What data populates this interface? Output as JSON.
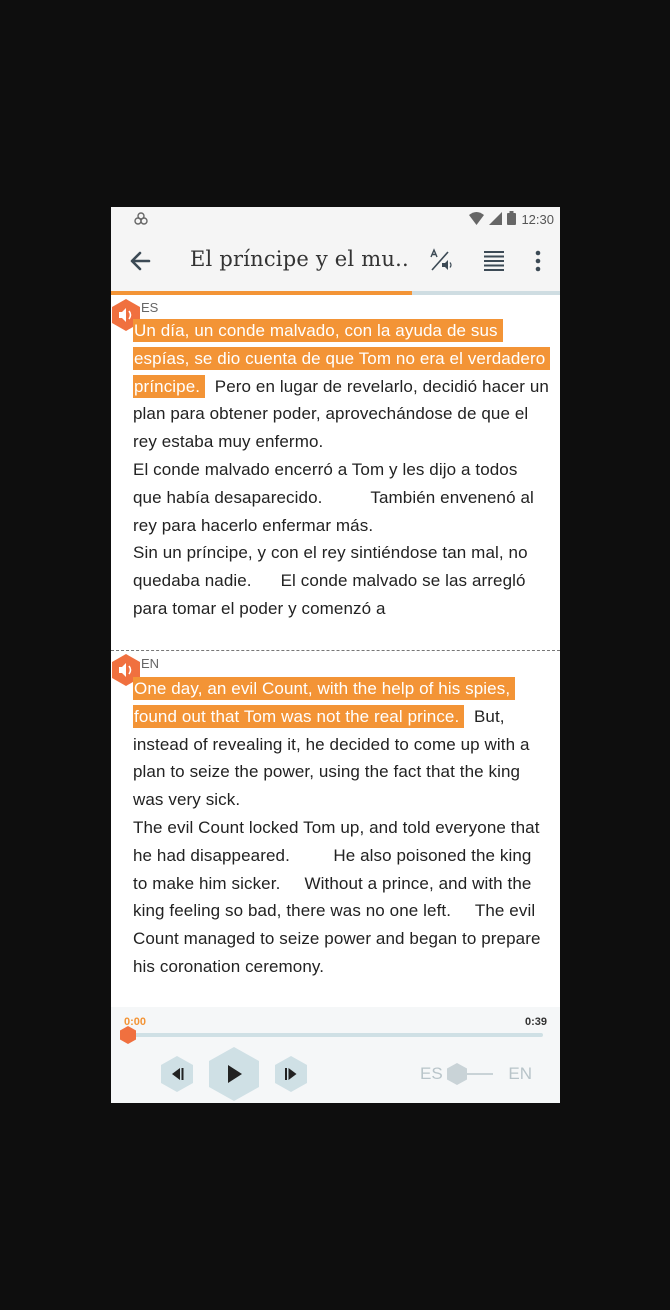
{
  "status_bar": {
    "time": "12:30"
  },
  "toolbar": {
    "title": "El príncipe y el mu..."
  },
  "reading_progress": 0.67,
  "spanish": {
    "lang_code": "ES",
    "highlighted": "Un día, un conde malvado, con la ayuda de sus espías, se dio cuenta de que Tom no era el verdadero príncipe.",
    "rest": "Pero en lugar de revelarlo, decidió hacer un plan para obtener poder, aprovechándose de que el rey estaba muy enfermo.",
    "para2": "El conde malvado encerró a Tom y les dijo a todos que había desaparecido.",
    "para2b": "También envenenó al rey para hacerlo enfermar más.",
    "para3": "Sin un príncipe, y con el rey sintiéndose tan mal, no quedaba nadie.",
    "para3b": "El conde malvado se las arregló para tomar el poder y comenzó a"
  },
  "english": {
    "lang_code": "EN",
    "highlighted": "One day, an evil Count, with the help of his spies, found out that Tom was not the real prince.",
    "rest": "But, instead of revealing it, he decided to come up with a plan to seize the power, using the fact that the king was very sick.",
    "para2": "The evil Count locked Tom up, and told everyone that he had disappeared.",
    "para2b": "He also poisoned the king to make him sicker.",
    "para2c": "Without a prince, and with the king feeling so bad, there was no one left.",
    "para2d": "The evil Count managed to seize power and began to prepare his coronation ceremony."
  },
  "player": {
    "current_time": "0:00",
    "total_time": "0:39",
    "lang_left": "ES",
    "lang_right": "EN"
  },
  "colors": {
    "accent": "#f39436",
    "teal_light": "#cfe0e5"
  },
  "icons": [
    "wifi-icon",
    "signal-icon",
    "battery-icon",
    "back-arrow-icon",
    "translate-audio-icon",
    "text-align-icon",
    "more-vert-icon",
    "speaker-icon",
    "previous-sentence-icon",
    "play-icon",
    "next-sentence-icon"
  ]
}
